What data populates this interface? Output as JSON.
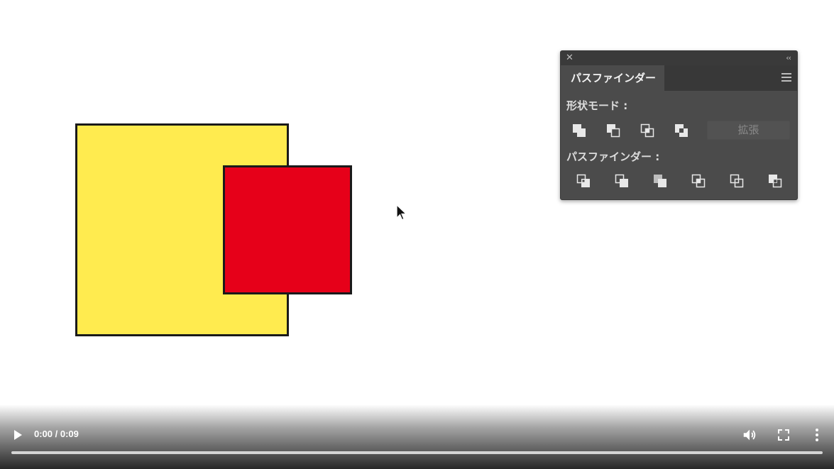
{
  "canvas": {
    "yellow_square_color": "#ffeb4f",
    "red_square_color": "#e60019",
    "stroke_color": "#1a1a1a"
  },
  "panel": {
    "close_icon": "close-icon",
    "collapse_icon": "double-chevron-left-icon",
    "tab_label": "パスファインダー",
    "menu_icon": "hamburger-menu-icon",
    "shape_modes_label": "形状モード :",
    "shape_modes": [
      "unite-icon",
      "minus-front-icon",
      "intersect-icon",
      "exclude-icon"
    ],
    "expand_label": "拡張",
    "pathfinders_label": "パスファインダー :",
    "pathfinders": [
      "divide-icon",
      "trim-icon",
      "merge-icon",
      "crop-icon",
      "outline-icon",
      "minus-back-icon"
    ]
  },
  "video": {
    "play_icon": "play-icon",
    "time": "0:00 / 0:09",
    "progress": 0,
    "volume_icon": "volume-icon",
    "fullscreen_icon": "fullscreen-icon",
    "more_icon": "more-vert-icon"
  }
}
